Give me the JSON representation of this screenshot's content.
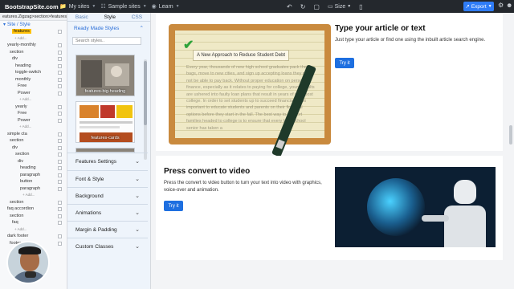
{
  "topbar": {
    "brand": "BootstrapSite.com",
    "my_sites": "My sites",
    "sample_sites": "Sample sites",
    "learn": "Learn",
    "size": "Size",
    "export": "Export"
  },
  "tree": {
    "breadcrumb": "eatures.Zigzag>section>features 3",
    "site_style": "Site / Style",
    "rows": [
      {
        "label": "features",
        "indent": 30,
        "selected": true
      },
      {
        "label": "+ Add...",
        "indent": 36,
        "add": true
      },
      {
        "label": "yearly-monthly",
        "indent": 18
      },
      {
        "label": "section",
        "indent": 24
      },
      {
        "label": "div",
        "indent": 30
      },
      {
        "label": "heading",
        "indent": 38
      },
      {
        "label": "toggle-switch",
        "indent": 38
      },
      {
        "label": "monthly",
        "indent": 38
      },
      {
        "label": "Free",
        "indent": 44
      },
      {
        "label": "Power",
        "indent": 44
      },
      {
        "label": "+ Add...",
        "indent": 48,
        "add": true
      },
      {
        "label": "yearly",
        "indent": 38
      },
      {
        "label": "Free",
        "indent": 44
      },
      {
        "label": "Power",
        "indent": 44
      },
      {
        "label": "+ Add...",
        "indent": 48,
        "add": true
      },
      {
        "label": "simple cta",
        "indent": 18
      },
      {
        "label": "section",
        "indent": 24
      },
      {
        "label": "div",
        "indent": 30
      },
      {
        "label": "section",
        "indent": 38
      },
      {
        "label": "div",
        "indent": 44
      },
      {
        "label": "heading",
        "indent": 50
      },
      {
        "label": "paragraph",
        "indent": 50
      },
      {
        "label": "button",
        "indent": 50
      },
      {
        "label": "paragraph",
        "indent": 50
      },
      {
        "label": "+ Add...",
        "indent": 56,
        "add": true
      },
      {
        "label": "section",
        "indent": 24
      },
      {
        "label": "faq accordion",
        "indent": 18
      },
      {
        "label": "section",
        "indent": 24
      },
      {
        "label": "faq",
        "indent": 30
      },
      {
        "label": "+ Add...",
        "indent": 36,
        "add": true
      },
      {
        "label": "dark footer",
        "indent": 18
      },
      {
        "label": "footer",
        "indent": 24
      }
    ]
  },
  "styles": {
    "tabs": [
      "Basic",
      "Style",
      "CSS"
    ],
    "ready_made": "Ready Made Styles",
    "search_placeholder": "Search styles..",
    "thumb1": "features-big-heading",
    "thumb2": "features-cards",
    "accordions": [
      "Features Settings",
      "Font & Style",
      "Background",
      "Animations",
      "Margin & Padding",
      "Custom Classes"
    ]
  },
  "canvas": {
    "article_title": "Type your article or text",
    "article_text": "Just type your article or find one using the inbuilt article search engine.",
    "article_btn": "Try it",
    "board_heading": "A New Approach to Reduce Student Debt",
    "board_text": "Every year, thousands of new high school graduates pack their bags, move to new cities, and sign up accepting loans they might not be able to pay back. Without proper education on personal finance, especially as it relates to paying for college, young adults are ushered into faulty loan plans that result in years of debt post college. In order to set students up to succeed financially, it is important to educate students and parents on their financial options before they start in the fall. The best way to support families headed to college is to ensure that every high school senior has taken a",
    "video_title": "Press convert to video",
    "video_text": "Press the convert to video button to turn your text into video with graphics, voice-over and animation.",
    "video_btn": "Try it"
  },
  "colors": {
    "accent": "#2f7cf6",
    "button": "#1e6fe0",
    "selected_node": "#ffc107",
    "topbar": "#24282d"
  }
}
